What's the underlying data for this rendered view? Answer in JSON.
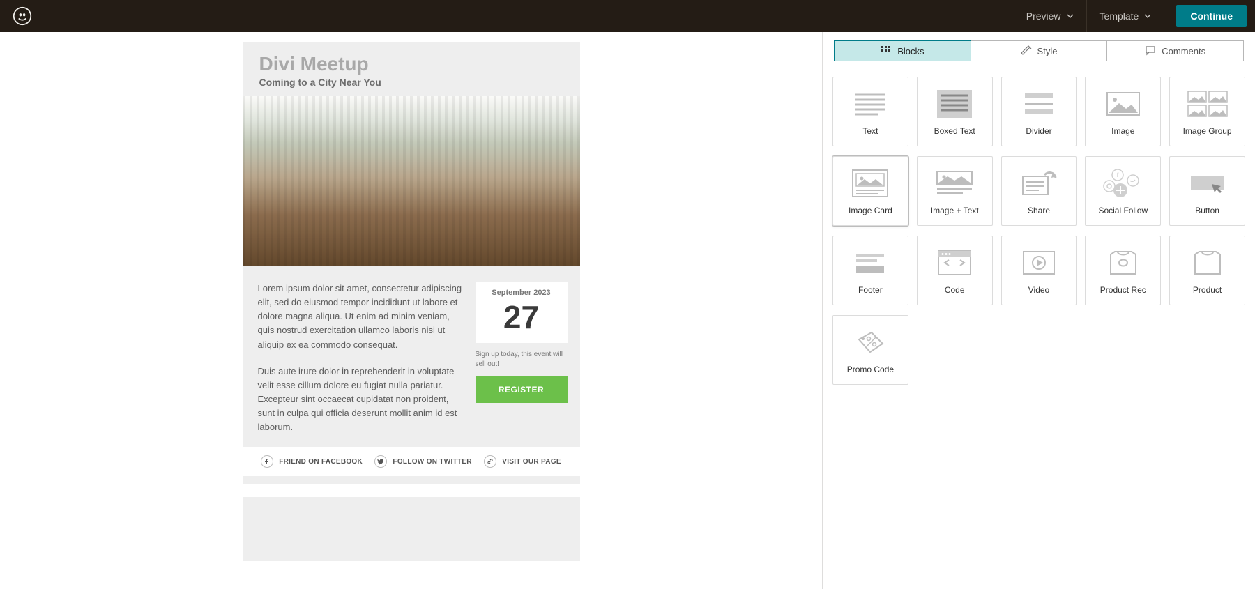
{
  "header": {
    "preview": "Preview",
    "template": "Template",
    "continue": "Continue"
  },
  "tabs": {
    "blocks": "Blocks",
    "style": "Style",
    "comments": "Comments"
  },
  "blocks": [
    {
      "id": "text",
      "label": "Text"
    },
    {
      "id": "boxed-text",
      "label": "Boxed Text"
    },
    {
      "id": "divider",
      "label": "Divider"
    },
    {
      "id": "image",
      "label": "Image"
    },
    {
      "id": "image-group",
      "label": "Image Group"
    },
    {
      "id": "image-card",
      "label": "Image Card"
    },
    {
      "id": "image-text",
      "label": "Image + Text"
    },
    {
      "id": "share",
      "label": "Share"
    },
    {
      "id": "social-follow",
      "label": "Social Follow"
    },
    {
      "id": "button",
      "label": "Button"
    },
    {
      "id": "footer",
      "label": "Footer"
    },
    {
      "id": "code",
      "label": "Code"
    },
    {
      "id": "video",
      "label": "Video"
    },
    {
      "id": "product-rec",
      "label": "Product Rec"
    },
    {
      "id": "product",
      "label": "Product"
    },
    {
      "id": "promo-code",
      "label": "Promo Code"
    }
  ],
  "email": {
    "title": "Divi Meetup",
    "subtitle": "Coming to a City Near You",
    "para1": "Lorem ipsum dolor sit amet, consectetur adipiscing elit, sed do eiusmod tempor incididunt ut labore et dolore magna aliqua. Ut enim ad minim veniam, quis nostrud exercitation ullamco laboris nisi ut aliquip ex ea commodo consequat.",
    "para2": "Duis aute irure dolor in reprehenderit in voluptate velit esse cillum dolore eu fugiat nulla pariatur. Excepteur sint occaecat cupidatat non proident, sunt in culpa qui officia deserunt mollit anim id est laborum.",
    "date_month": "September 2023",
    "date_day": "27",
    "sellout": "Sign up today, this event will sell out!",
    "register": "REGISTER",
    "social": {
      "fb": "FRIEND ON FACEBOOK",
      "tw": "FOLLOW ON TWITTER",
      "link": "VISIT OUR PAGE"
    }
  }
}
